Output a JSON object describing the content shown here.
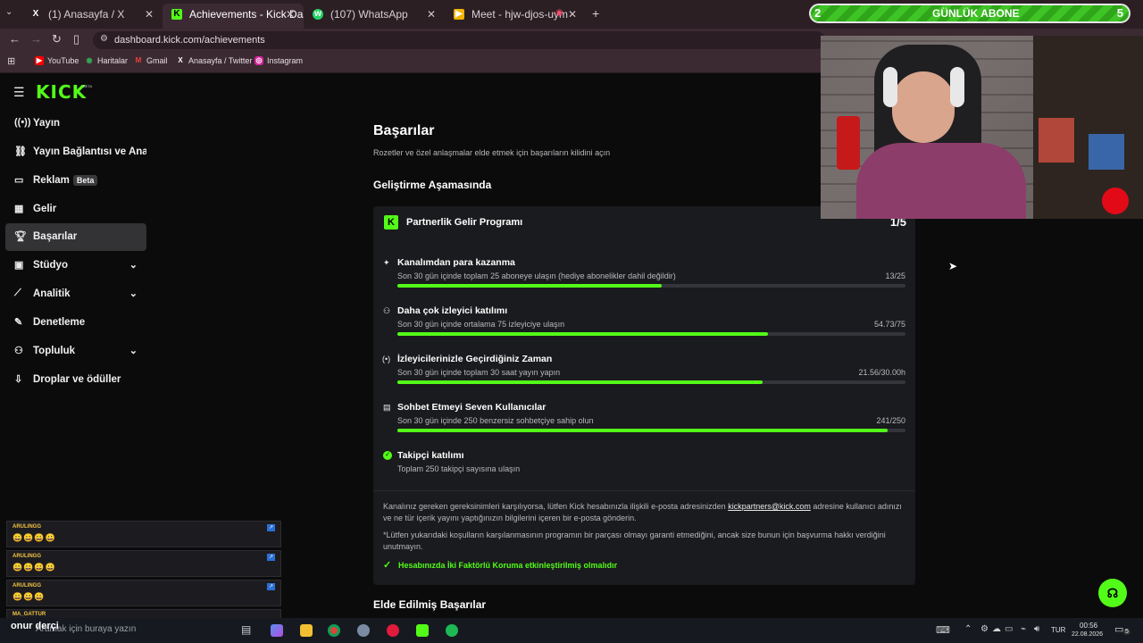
{
  "browser": {
    "tabs": [
      {
        "title": "(1) Anasayfa / X",
        "icon": "x-icon"
      },
      {
        "title": "Achievements - Kick Dashboard",
        "icon": "kick-icon"
      },
      {
        "title": "(107) WhatsApp",
        "icon": "whatsapp-icon"
      },
      {
        "title": "Meet - hjw-djos-uym",
        "icon": "meet-icon"
      }
    ],
    "new_tab": "+",
    "url": "dashboard.kick.com/achievements",
    "bookmarks": [
      "YouTube",
      "Haritalar",
      "Gmail",
      "Anasayfa / Twitter",
      "Instagram"
    ]
  },
  "overlay": {
    "sub_count": "2",
    "sub_label": "GÜNLÜK ABONE",
    "sub_goal": "5",
    "streamer_name": "onur derçi",
    "alerts": [
      {
        "name": "ARULINGG",
        "emotes": "😀😀😀😀"
      },
      {
        "name": "ARULINGG",
        "emotes": "😀😀😀😀"
      },
      {
        "name": "ARULINGG",
        "emotes": "😀😀😀"
      },
      {
        "name": "MA_GATTUR",
        "emotes": ""
      }
    ]
  },
  "sidebar": {
    "logo": "KICK",
    "logo_badge": "BETA",
    "items": [
      {
        "label": "Yayın",
        "icon": "broadcast-icon"
      },
      {
        "label": "Yayın Bağlantısı ve Anahtarı",
        "icon": "link-icon"
      },
      {
        "label": "Reklam",
        "icon": "ad-icon",
        "badge": "Beta"
      },
      {
        "label": "Gelir",
        "icon": "revenue-icon"
      },
      {
        "label": "Başarılar",
        "icon": "trophy-icon"
      },
      {
        "label": "Stüdyo",
        "icon": "studio-icon"
      },
      {
        "label": "Analitik",
        "icon": "analytics-icon"
      },
      {
        "label": "Denetleme",
        "icon": "moderation-icon"
      },
      {
        "label": "Topluluk",
        "icon": "community-icon"
      },
      {
        "label": "Droplar ve ödüller",
        "icon": "drops-icon"
      }
    ]
  },
  "main": {
    "title": "Başarılar",
    "subtitle": "Rozetler ve özel anlaşmalar elde etmek için başarıların kilidini açın",
    "section_progress": "Geliştirme Aşamasında",
    "card": {
      "title": "Partnerlik Gelir Programı",
      "progress": "1/5",
      "requirements": [
        {
          "title": "Kanalımdan para kazanma",
          "desc": "Son 30 gün içinde toplam 25 aboneye ulaşın (hediye abonelikler dahil değildir)",
          "value": "13/25",
          "ratio": 0.52
        },
        {
          "title": "Daha çok izleyici katılımı",
          "desc": "Son 30 gün içinde ortalama 75 izleyiciye ulaşın",
          "value": "54.73/75",
          "ratio": 0.7297
        },
        {
          "title": "İzleyicilerinizle Geçirdiğiniz Zaman",
          "desc": "Son 30 gün içinde toplam 30 saat yayın yapın",
          "value": "21.56/30.00h",
          "ratio": 0.7187
        },
        {
          "title": "Sohbet Etmeyi Seven Kullanıcılar",
          "desc": "Son 30 gün içinde 250 benzersiz sohbetçiye sahip olun",
          "value": "241/250",
          "ratio": 0.964
        },
        {
          "title": "Takipçi katılımı",
          "desc": "Toplam 250 takipçi sayısına ulaşın",
          "value": "",
          "ratio": null
        }
      ],
      "note1_pre": "Kanalınız gereken gereksinimleri karşılıyorsa, lütfen Kick hesabınızla ilişkili e-posta adresinizden",
      "note1_link": "kickpartners@kick.com",
      "note1_post": "adresine kullanıcı adınızı ve ne tür içerik yayını yaptığınızın bilgilerini içeren bir e-posta gönderin.",
      "note2": "*Lütfen yukarıdaki koşulların karşılanmasının programın bir parçası olmayı garanti etmediğini, ancak size bunun için başvurma hakkı verdiğini unutmayın.",
      "twofa": "Hesabınızda İki Faktörlü Koruma etkinleştirilmiş olmalıdır"
    },
    "section_earned": "Elde Edilmiş Başarılar"
  },
  "taskbar": {
    "search_placeholder": "Aramak için buraya yazın",
    "lang": "TUR",
    "time": "00:56",
    "date": "22.08.2026",
    "notif": "5"
  },
  "colors": {
    "accent": "#53fc18",
    "tab_bg": "#2b1f24",
    "chrome_bg": "#3c2a33",
    "card_bg": "#1a1b1e"
  }
}
